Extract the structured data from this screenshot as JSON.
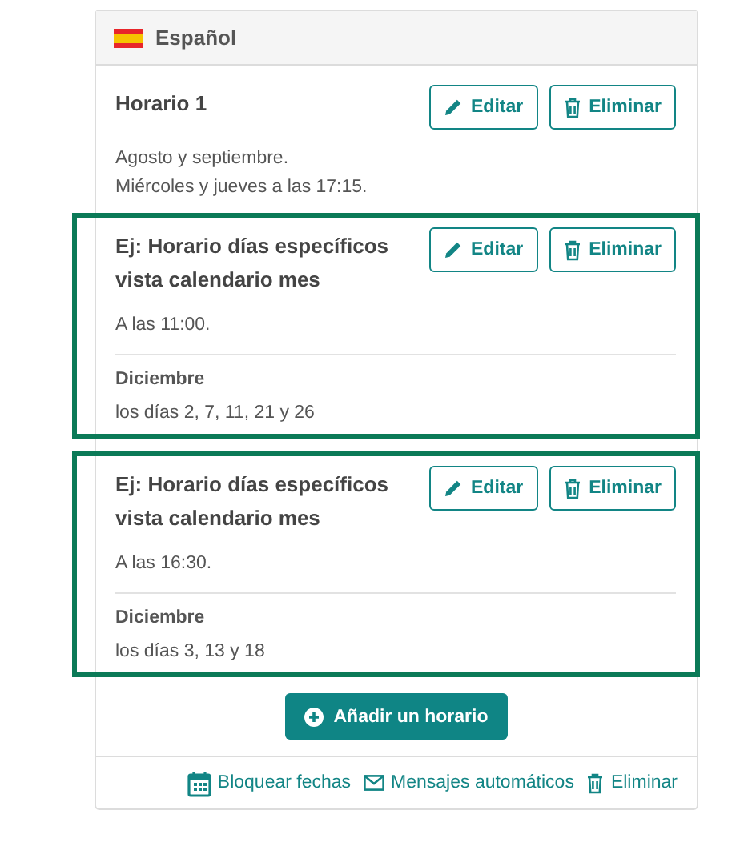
{
  "panel": {
    "language": "Español"
  },
  "schedules": [
    {
      "title": "Horario 1",
      "highlighted": false,
      "lines": [
        "Agosto y septiembre.",
        "Miércoles y jueves a las 17:15."
      ],
      "buttons": [
        "Editar",
        "Eliminar"
      ]
    },
    {
      "title": "Ej: Horario días específicos vista calendario mes",
      "highlighted": true,
      "lines": [
        "A las 11:00."
      ],
      "sections": [
        {
          "month": "Diciembre",
          "days": "los días 2, 7, 11, 21 y 26"
        }
      ],
      "buttons": [
        "Editar",
        "Eliminar"
      ]
    },
    {
      "title": "Ej: Horario días específicos vista calendario mes",
      "highlighted": true,
      "lines": [
        "A las 16:30."
      ],
      "sections": [
        {
          "month": "Diciembre",
          "days": "los días 3, 13 y 18"
        }
      ],
      "buttons": [
        "Editar",
        "Eliminar"
      ]
    }
  ],
  "add_button": "Añadir un horario",
  "footer_links": [
    "Bloquear fechas",
    "Mensajes automáticos",
    "Eliminar"
  ]
}
